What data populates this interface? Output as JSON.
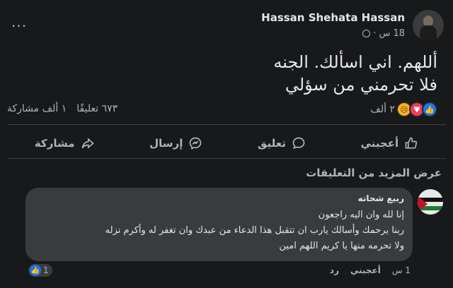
{
  "post": {
    "author": "Hassan Shehata Hassan",
    "time": "18 س",
    "privacy_icon": "globe-icon",
    "more_label": "...",
    "text_line1": "أللهم. اني اسألك. الجنه",
    "text_line2": "فلا تحرمني من سؤلي"
  },
  "stats": {
    "reactions_count": "٢ ألف",
    "reaction_icons": [
      "sad-icon",
      "love-icon",
      "like-icon"
    ],
    "comments": "٦٧٣ تعليقًا",
    "shares": "١ ألف مشاركة"
  },
  "actions": {
    "like": "أعجبني",
    "comment": "تعليق",
    "send": "إرسال",
    "share": "مشاركة"
  },
  "comments": {
    "view_more": "عرض المزيد من التعليقات",
    "items": [
      {
        "name": "ربيع شحاته",
        "line1": "إنا لله وان اليه راجعون",
        "line2": "ربنا يرحمك وأسالك يارب ان تتقبل هذا الدعاء من عبدك وان تغفر له وأكرم نزله",
        "line3": "ولا تحرمه منها يا كريم اللهم امين",
        "time": "1 س",
        "like_label": "أعجبني",
        "reply_label": "رد",
        "reaction_count": "1"
      }
    ]
  },
  "colors": {
    "background": "#18191a",
    "bubble": "#3a3b3c",
    "accent": "#1877f2"
  }
}
